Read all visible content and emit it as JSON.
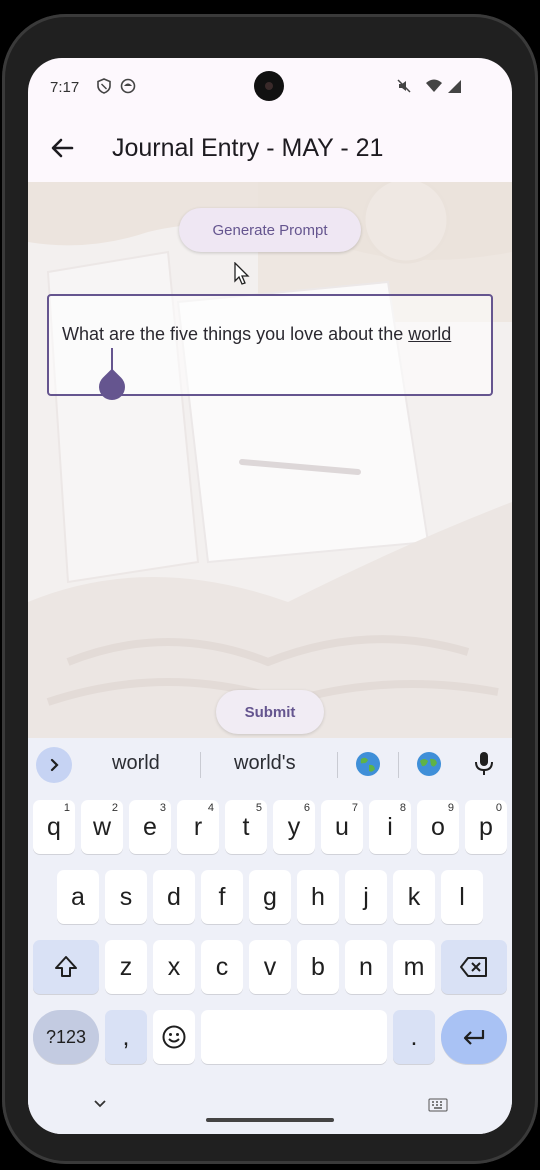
{
  "status_bar": {
    "time": "7:17"
  },
  "app_bar": {
    "title": "Journal Entry - MAY - 21"
  },
  "main": {
    "generate_prompt_label": "Generate Prompt",
    "prompt_text": "What are the five things you love about the",
    "prompt_last_word": "world",
    "submit_label": "Submit"
  },
  "keyboard": {
    "suggestions": [
      "world",
      "world's"
    ],
    "row1": [
      {
        "key": "q",
        "hint": "1"
      },
      {
        "key": "w",
        "hint": "2"
      },
      {
        "key": "e",
        "hint": "3"
      },
      {
        "key": "r",
        "hint": "4"
      },
      {
        "key": "t",
        "hint": "5"
      },
      {
        "key": "y",
        "hint": "6"
      },
      {
        "key": "u",
        "hint": "7"
      },
      {
        "key": "i",
        "hint": "8"
      },
      {
        "key": "o",
        "hint": "9"
      },
      {
        "key": "p",
        "hint": "0"
      }
    ],
    "row2": [
      "a",
      "s",
      "d",
      "f",
      "g",
      "h",
      "j",
      "k",
      "l"
    ],
    "row3": [
      "z",
      "x",
      "c",
      "v",
      "b",
      "n",
      "m"
    ],
    "num_mode_label": "?123",
    "comma_label": ",",
    "period_label": "."
  },
  "colors": {
    "accent": "#65558f",
    "keyboard_bg": "#eef0f8",
    "enter_key": "#a9c2f4"
  },
  "icons": {
    "status": [
      "shield-icon",
      "circle-app-icon",
      "mute-icon",
      "wifi-icon",
      "signal-icon"
    ],
    "app_bar": [
      "back-arrow-icon"
    ],
    "keyboard": [
      "chevron-right-icon",
      "globe-icon",
      "microphone-icon",
      "shift-icon",
      "backspace-icon",
      "emoji-icon",
      "enter-icon",
      "chevron-down-icon",
      "keyboard-icon"
    ]
  }
}
